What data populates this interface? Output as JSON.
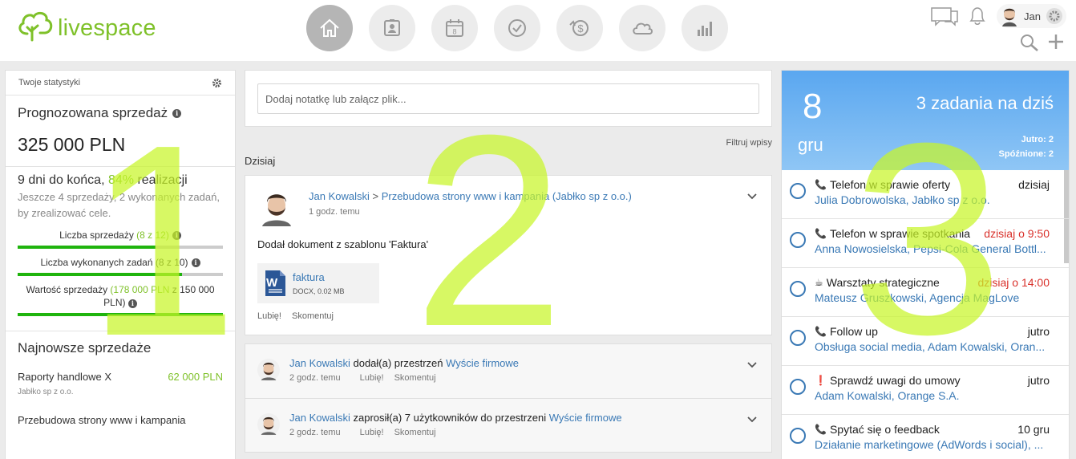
{
  "header": {
    "logo_text": "livespace",
    "nav": [
      {
        "name": "home",
        "active": true
      },
      {
        "name": "contacts"
      },
      {
        "name": "calendar",
        "text": "8"
      },
      {
        "name": "tasks"
      },
      {
        "name": "deals"
      },
      {
        "name": "cloud"
      },
      {
        "name": "reports"
      }
    ],
    "user_name": "Jan"
  },
  "stats": {
    "header": "Twoje statystyki",
    "forecast_label": "Prognozowana sprzedaż",
    "forecast_value": "325 000 PLN",
    "days_left": "9 dni do końca, ",
    "realization_pct": "84%",
    "realization_word": " realizacji",
    "subtext": "Jeszcze 4 sprzedaży, 2 wykonanych zadań, by zrealizować cele.",
    "bars": [
      {
        "label": "Liczba sprzedaży ",
        "detail": "(8 z 12)",
        "progress": 0.67
      },
      {
        "label": "Liczba wykonanych zadań (8 z 10)",
        "detail": "",
        "progress": 0.8
      },
      {
        "label": "Wartość sprzedaży ",
        "detail": "(178 000 PLN",
        "tail": " z 150 000 PLN)",
        "progress": 1.0
      }
    ],
    "sales_title": "Najnowsze sprzedaże",
    "sales": [
      {
        "name": "Raporty handlowe X",
        "amount": "62 000 PLN",
        "company": "Jabłko sp z o.o."
      },
      {
        "name": "Przebudowa strony www i kampania"
      }
    ]
  },
  "feed": {
    "note_placeholder": "Dodaj notatkę lub załącz plik...",
    "filter_label": "Filtruj wpisy",
    "today_label": "Dzisiaj",
    "post": {
      "author": "Jan Kowalski",
      "separator": " > ",
      "target": "Przebudowa strony www i kampania (Jabłko sp z o.o.)",
      "time": "1 godz. temu",
      "body": "Dodał dokument z szablonu 'Faktura'",
      "file_name": "faktura",
      "file_meta": "DOCX, 0.02 MB",
      "like": "Lubię!",
      "comment": "Skomentuj"
    },
    "items": [
      {
        "author": "Jan Kowalski",
        "action": " dodał(a) przestrzeń ",
        "target": "Wyście firmowe",
        "time": "2 godz. temu",
        "like": "Lubię!",
        "comment": "Skomentuj"
      },
      {
        "author": "Jan Kowalski",
        "action": " zaprosił(a) 7 użytkowników do przestrzeni ",
        "target": "Wyście firmowe",
        "time": "2 godz. temu",
        "like": "Lubię!",
        "comment": "Skomentuj"
      }
    ]
  },
  "tasks": {
    "day": "8",
    "month": "gru",
    "title": "3 zadania na dziś",
    "tomorrow": "Jutro: 2",
    "late": "Spóźnione: 2",
    "list": [
      {
        "icon": "phone-icon",
        "glyph": "📞",
        "title": "Telefon w sprawie oferty",
        "date": "dzisiaj",
        "red": false,
        "links": "Julia Dobrowolska, Jabłko sp z o.o."
      },
      {
        "icon": "phone-icon",
        "glyph": "📞",
        "title": "Telefon w sprawie spotkania",
        "date": "dzisiaj o 9:50",
        "red": true,
        "links": "Anna Nowosielska, Pepsi-Cola General Bottl..."
      },
      {
        "icon": "coffee-icon",
        "glyph": "☕",
        "title": "Warsztaty strategiczne",
        "date": "dzisiaj o 14:00",
        "red": true,
        "links": "Mateusz Gruszkowski, Agencja MagLove"
      },
      {
        "icon": "phone-icon",
        "glyph": "📞",
        "title": "Follow up",
        "date": "jutro",
        "red": false,
        "links": "Obsługa social media, Adam Kowalski, Oran..."
      },
      {
        "icon": "exclamation-icon",
        "glyph": "❗",
        "title": "Sprawdź uwagi do umowy",
        "date": "jutro",
        "red": false,
        "links": "Adam Kowalski, Orange S.A."
      },
      {
        "icon": "phone-icon",
        "glyph": "📞",
        "title": "Spytać się o feedback",
        "date": "10 gru",
        "red": false,
        "links": "Działanie marketingowe (AdWords i social), ..."
      }
    ]
  },
  "overlay": {
    "one": "1",
    "two": "2",
    "three": "3"
  }
}
